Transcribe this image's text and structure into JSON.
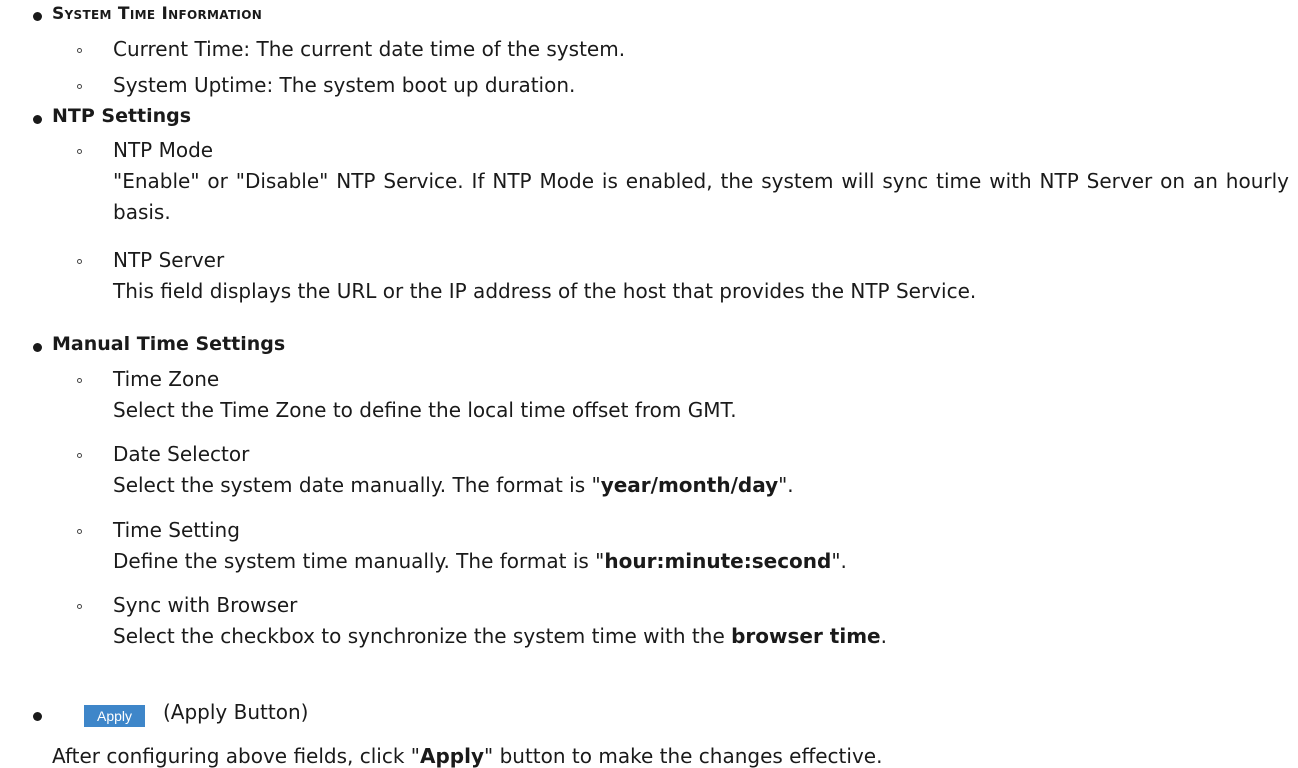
{
  "sections": {
    "system_time": {
      "title": "System Time Information",
      "items": [
        "Current Time: The current date time of the system.",
        "System Uptime: The system boot up duration."
      ]
    },
    "ntp": {
      "title": "NTP Settings",
      "mode_label": "NTP Mode",
      "mode_desc": "\"Enable\" or \"Disable\" NTP Service. If NTP Mode is enabled, the system will sync time with NTP Server on an hourly basis.",
      "server_label": "NTP Server",
      "server_desc": "This field displays the URL or the IP address of the host that provides the NTP Service."
    },
    "manual": {
      "title": "Manual Time Settings",
      "tz_label": "Time Zone",
      "tz_desc": "Select the Time Zone to define the local time offset from GMT.",
      "date_label": "Date Selector",
      "date_desc_pre": "Select the system date manually. The format is \"",
      "date_format": "year/month/day",
      "date_desc_post": "\".",
      "time_label": "Time Setting",
      "time_desc_pre": "Define the system time manually. The format is \"",
      "time_format": "hour:minute:second",
      "time_desc_post": "\".",
      "sync_label": "Sync with Browser",
      "sync_desc_pre": "Select the checkbox to synchronize the system time with the ",
      "sync_bold": "browser time",
      "sync_desc_post": "."
    },
    "apply": {
      "button_label": "Apply",
      "caption": "(Apply Button)",
      "desc_pre": "After configuring above fields, click \"",
      "desc_bold": "Apply",
      "desc_post": "\" button to make the changes effective."
    }
  }
}
